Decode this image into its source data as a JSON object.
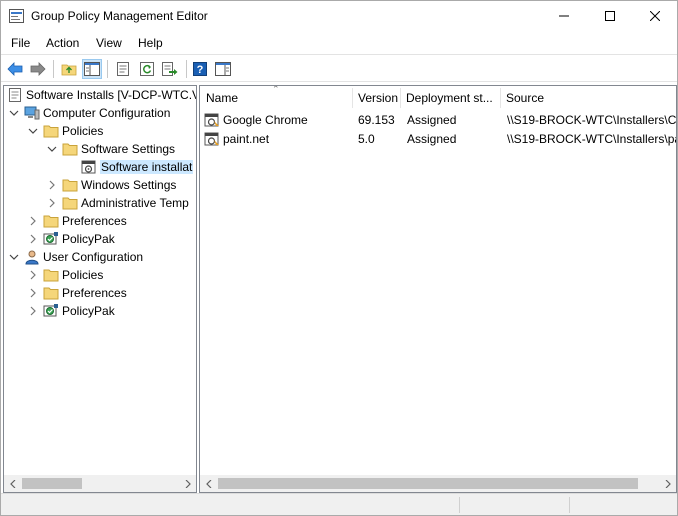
{
  "window": {
    "title": "Group Policy Management Editor"
  },
  "menu": {
    "file": "File",
    "action": "Action",
    "view": "View",
    "help": "Help"
  },
  "toolbar": {
    "buttons": [
      "back-icon",
      "forward-icon",
      "up-folder-icon",
      "show-hide-tree-icon",
      "properties-icon",
      "refresh-icon",
      "export-list-icon",
      "help-icon",
      "show-action-pane-icon"
    ]
  },
  "tree": {
    "root": "Software Installs [V-DCP-WTC.V",
    "computer_config": "Computer Configuration",
    "cc_policies": "Policies",
    "software_settings": "Software Settings",
    "software_installation": "Software installat",
    "windows_settings": "Windows Settings",
    "admin_templates": "Administrative Temp",
    "cc_preferences": "Preferences",
    "cc_policypak": "PolicyPak",
    "user_config": "User Configuration",
    "uc_policies": "Policies",
    "uc_preferences": "Preferences",
    "uc_policypak": "PolicyPak"
  },
  "list": {
    "columns": {
      "name": "Name",
      "version": "Version",
      "deployment": "Deployment st...",
      "source": "Source"
    },
    "rows": [
      {
        "name": "Google Chrome",
        "version": "69.153",
        "deployment": "Assigned",
        "source": "\\\\S19-BROCK-WTC\\Installers\\Ch"
      },
      {
        "name": "paint.net",
        "version": "5.0",
        "deployment": "Assigned",
        "source": "\\\\S19-BROCK-WTC\\Installers\\pa"
      }
    ]
  },
  "colors": {
    "selection": "#cce8ff",
    "toolbar_active": "#cce4f7",
    "folder": "#f5d67a"
  }
}
